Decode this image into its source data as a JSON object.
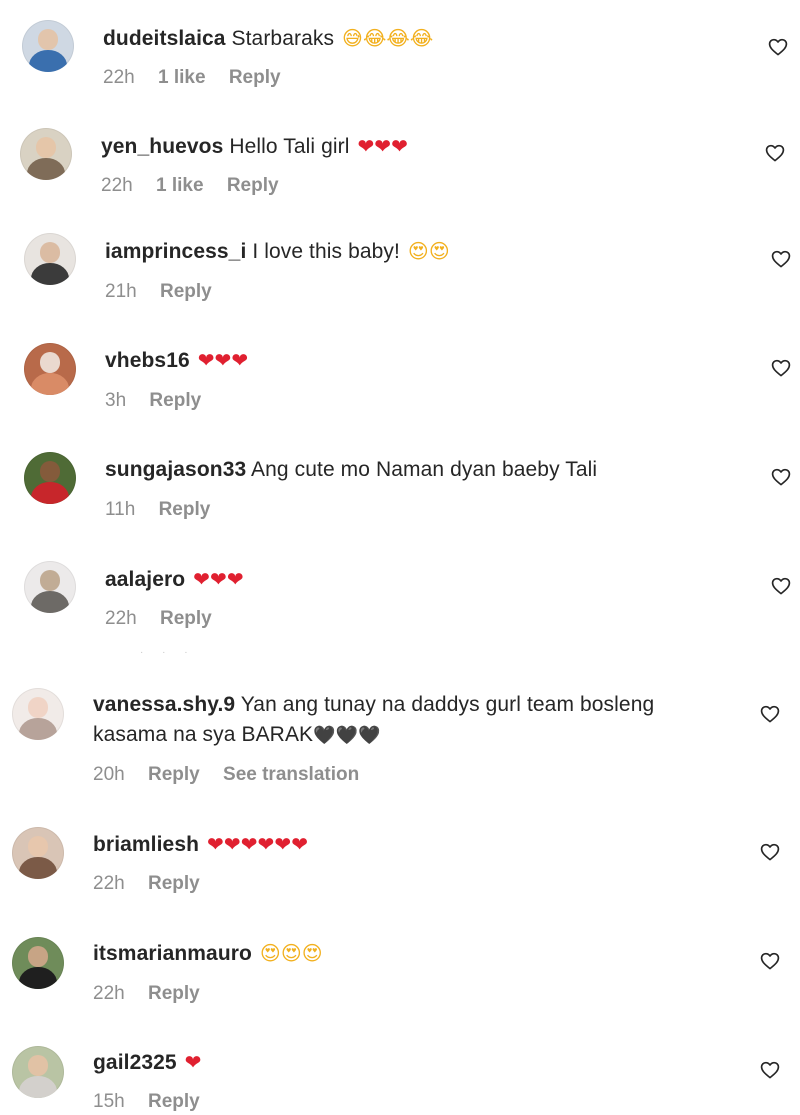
{
  "comments": [
    {
      "username": "dudeitslaica",
      "text": "Starbaraks",
      "emoji": "😅😂😂😂",
      "emoji_tone": "yellow",
      "time": "22h",
      "likes": "1 like",
      "reply": "Reply",
      "translation": "",
      "avatar": {
        "bg": "#cfd8e3",
        "face": "#e3c3a5",
        "body": "#3a6fae"
      }
    },
    {
      "username": "yen_huevos",
      "text": "Hello Tali girl",
      "emoji": "❤❤❤",
      "emoji_tone": "red",
      "time": "22h",
      "likes": "1 like",
      "reply": "Reply",
      "translation": "",
      "avatar": {
        "bg": "#d9d2c3",
        "face": "#e6c4a6",
        "body": "#7f6c58"
      }
    },
    {
      "username": "iamprincess_i",
      "text": "I love this baby!",
      "emoji": "😍😍",
      "emoji_tone": "yellow",
      "time": "21h",
      "likes": "",
      "reply": "Reply",
      "translation": "",
      "avatar": {
        "bg": "#e8e4e0",
        "face": "#d9b79c",
        "body": "#3b3b3b"
      }
    },
    {
      "username": "vhebs16",
      "text": "",
      "emoji": "❤❤❤",
      "emoji_tone": "red",
      "time": "3h",
      "likes": "",
      "reply": "Reply",
      "translation": "",
      "avatar": {
        "bg": "#b86a4a",
        "face": "#f0e6de",
        "body": "#d98b66"
      }
    },
    {
      "username": "sungajason33",
      "text": "Ang cute mo Naman dyan baeby Tali",
      "emoji": "",
      "emoji_tone": "",
      "time": "11h",
      "likes": "",
      "reply": "Reply",
      "translation": "",
      "avatar": {
        "bg": "#4f6b36",
        "face": "#8a5a3c",
        "body": "#c7262b"
      }
    },
    {
      "username": "aalajero",
      "text": "",
      "emoji": "❤❤❤",
      "emoji_tone": "red",
      "time": "22h",
      "likes": "",
      "reply": "Reply",
      "translation": "",
      "avatar": {
        "bg": "#eceaea",
        "face": "#bda58c",
        "body": "#6d6a66"
      }
    },
    {
      "username": "vanessa.shy.9",
      "text": "Yan ang tunay na daddys gurl team bosleng kasama na sya BARAK",
      "emoji": "🖤🖤🖤",
      "emoji_tone": "black",
      "time": "20h",
      "likes": "",
      "reply": "Reply",
      "translation": "See translation",
      "avatar": {
        "bg": "#f1ebe8",
        "face": "#f0d2c2",
        "body": "#b7a39a"
      }
    },
    {
      "username": "briamliesh",
      "text": "",
      "emoji": "❤❤❤❤❤❤",
      "emoji_tone": "red",
      "time": "22h",
      "likes": "",
      "reply": "Reply",
      "translation": "",
      "avatar": {
        "bg": "#d9c5b6",
        "face": "#e8c7ac",
        "body": "#7b5a47"
      }
    },
    {
      "username": "itsmarianmauro",
      "text": "",
      "emoji": "😍😍😍",
      "emoji_tone": "yellow",
      "time": "22h",
      "likes": "",
      "reply": "Reply",
      "translation": "",
      "avatar": {
        "bg": "#6f8c5a",
        "face": "#d0a68a",
        "body": "#1f1f1f"
      }
    },
    {
      "username": "gail2325",
      "text": "",
      "emoji": "❤",
      "emoji_tone": "red",
      "time": "15h",
      "likes": "",
      "reply": "Reply",
      "translation": "",
      "avatar": {
        "bg": "#b9c4a4",
        "face": "#e5c2a5",
        "body": "#d3d0cc"
      }
    }
  ]
}
